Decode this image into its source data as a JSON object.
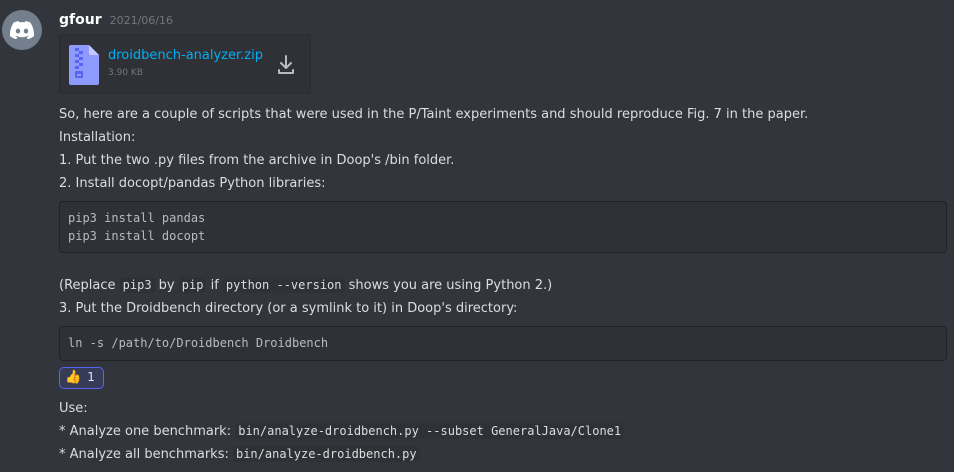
{
  "message": {
    "author": "gfour",
    "timestamp": "2021/06/16"
  },
  "attachment": {
    "file_name": "droidbench-analyzer.zip",
    "file_size": "3.90 KB"
  },
  "content": {
    "intro": "So, here are a couple of scripts that were used in the P/Taint experiments and should reproduce Fig. 7 in the paper.",
    "installation_heading": "Installation:",
    "step1": "1. Put the two .py files from the archive in Doop's /bin folder.",
    "step2": "2. Install docopt/pandas Python libraries:",
    "code_block_1": "pip3 install pandas\npip3 install docopt",
    "note_prefix": "(Replace ",
    "note_code_1": "pip3",
    "note_mid_1": " by ",
    "note_code_2": "pip",
    "note_mid_2": " if ",
    "note_code_3": "python --version",
    "note_suffix": " shows you are using Python 2.)",
    "step3": "3. Put the Droidbench directory (or a symlink to it) in Doop's directory:",
    "code_block_2": "ln -s /path/to/Droidbench Droidbench",
    "reaction": {
      "emoji": "👍",
      "count": "1"
    },
    "use_heading": "Use:",
    "use_one_prefix": "* Analyze one benchmark: ",
    "use_one_code": "bin/analyze-droidbench.py --subset GeneralJava/Clone1",
    "use_all_prefix": "* Analyze all benchmarks: ",
    "use_all_code": "bin/analyze-droidbench.py"
  },
  "icons": {
    "avatar": "discord-logo-icon",
    "file": "zip-file-icon",
    "download": "download-icon"
  },
  "colors": {
    "background": "#32353b",
    "link": "#00b0f4",
    "username": "#ffffff",
    "reaction_border": "#5865f2"
  }
}
